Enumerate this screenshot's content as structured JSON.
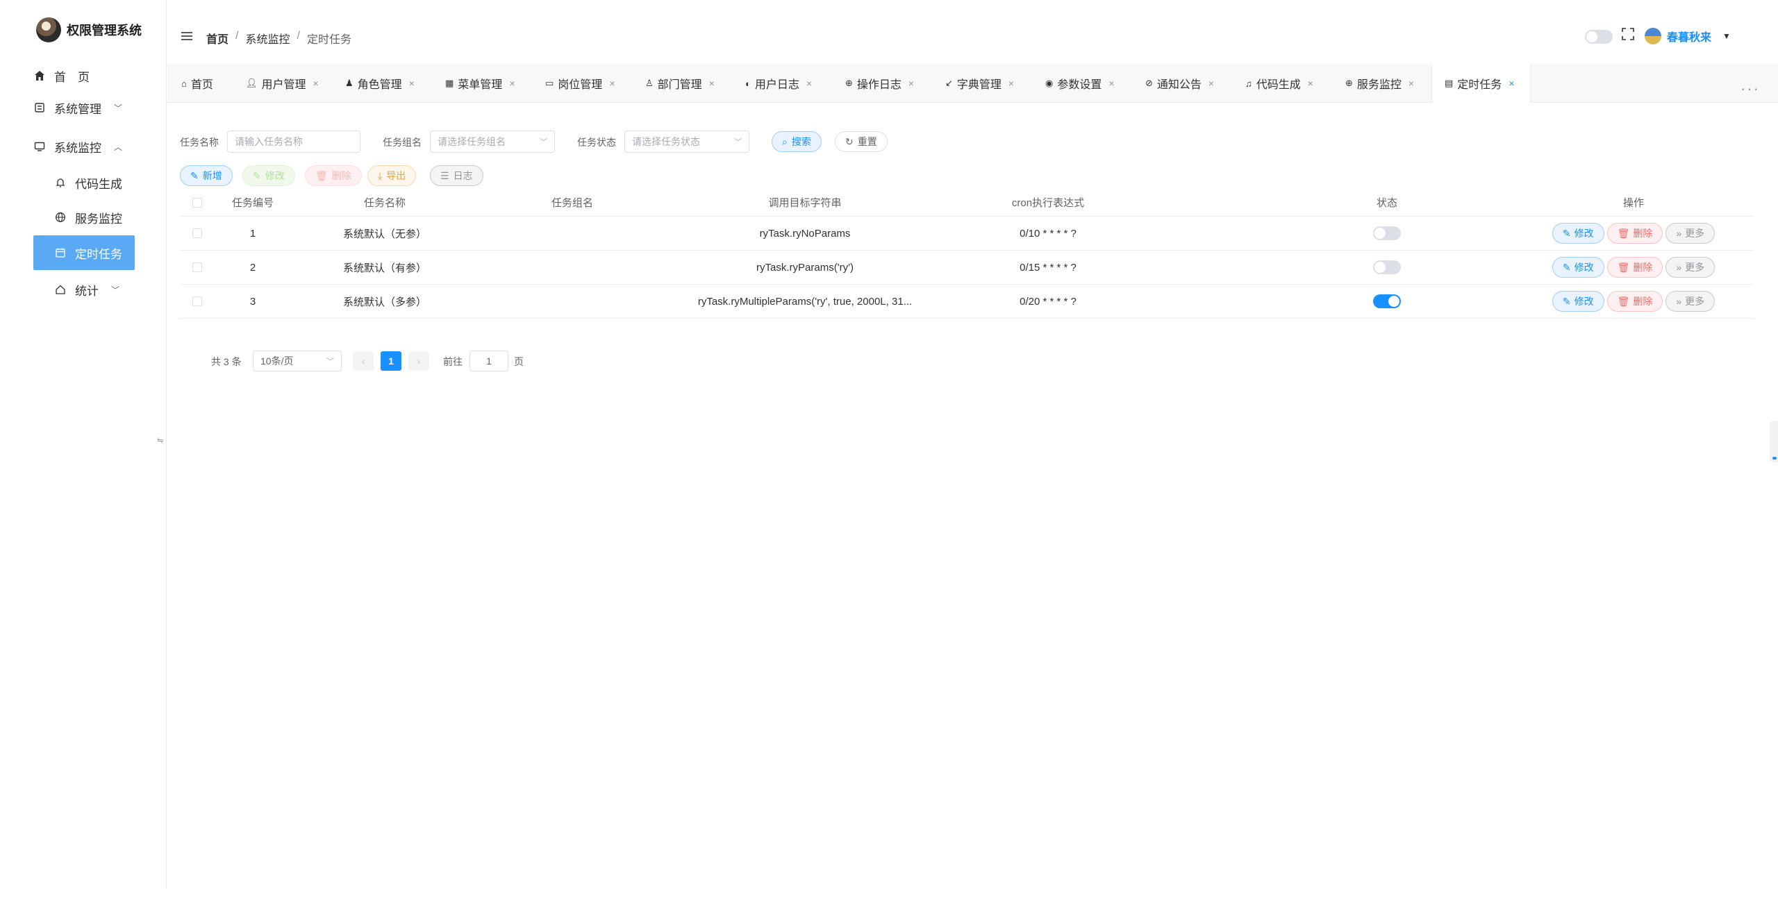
{
  "app": {
    "title": "权限管理系统"
  },
  "sidebar": {
    "items": [
      {
        "label": "首　页"
      },
      {
        "label": "系统管理"
      },
      {
        "label": "系统监控"
      },
      {
        "label": "代码生成"
      },
      {
        "label": "服务监控"
      },
      {
        "label": "定时任务"
      },
      {
        "label": "统计"
      }
    ]
  },
  "header": {
    "breadcrumb": [
      "首页",
      "系统监控",
      "定时任务"
    ],
    "user_name": "春暮秋来"
  },
  "tabs": [
    {
      "label": "首页",
      "icon": "home-icon",
      "closable": false
    },
    {
      "label": "用户管理",
      "icon": "user-icon",
      "closable": true
    },
    {
      "label": "角色管理",
      "icon": "role-icon",
      "closable": true
    },
    {
      "label": "菜单管理",
      "icon": "grid-icon",
      "closable": true
    },
    {
      "label": "岗位管理",
      "icon": "post-icon",
      "closable": true
    },
    {
      "label": "部门管理",
      "icon": "user-icon",
      "closable": true
    },
    {
      "label": "用户日志",
      "icon": "log-icon",
      "closable": true
    },
    {
      "label": "操作日志",
      "icon": "globe-icon",
      "closable": true
    },
    {
      "label": "字典管理",
      "icon": "arrow-icon",
      "closable": true
    },
    {
      "label": "参数设置",
      "icon": "chrome-icon",
      "closable": true
    },
    {
      "label": "通知公告",
      "icon": "compass-icon",
      "closable": true
    },
    {
      "label": "代码生成",
      "icon": "bell-icon",
      "closable": true
    },
    {
      "label": "服务监控",
      "icon": "globe-icon",
      "closable": true
    },
    {
      "label": "定时任务",
      "icon": "calendar-icon",
      "closable": true,
      "active": true
    }
  ],
  "search": {
    "name_label": "任务名称",
    "name_placeholder": "请输入任务名称",
    "group_label": "任务组名",
    "group_placeholder": "请选择任务组名",
    "status_label": "任务状态",
    "status_placeholder": "请选择任务状态",
    "search_btn": "搜索",
    "reset_btn": "重置"
  },
  "toolbar": {
    "add": "新增",
    "edit": "修改",
    "delete": "删除",
    "export": "导出",
    "log": "日志"
  },
  "table": {
    "headers": [
      "任务编号",
      "任务名称",
      "任务组名",
      "调用目标字符串",
      "cron执行表达式",
      "状态",
      "操作"
    ],
    "rows": [
      {
        "id": "1",
        "name": "系统默认（无参）",
        "group": "",
        "target": "ryTask.ryNoParams",
        "cron": "0/10 * * * * ?",
        "enabled": false
      },
      {
        "id": "2",
        "name": "系统默认（有参）",
        "group": "",
        "target": "ryTask.ryParams('ry')",
        "cron": "0/15 * * * * ?",
        "enabled": false
      },
      {
        "id": "3",
        "name": "系统默认（多参）",
        "group": "",
        "target": "ryTask.ryMultipleParams('ry', true, 2000L, 31...",
        "cron": "0/20 * * * * ?",
        "enabled": true
      }
    ],
    "op_edit": "修改",
    "op_delete": "删除",
    "op_more": "更多"
  },
  "pagination": {
    "total": "共 3 条",
    "page_size": "10条/页",
    "current": "1",
    "goto_label": "前往",
    "goto_value": "1",
    "page_suffix": "页"
  },
  "colors": {
    "primary": "#1890ff",
    "active_menu": "#5aa9f5",
    "danger": "#f56c6c"
  }
}
